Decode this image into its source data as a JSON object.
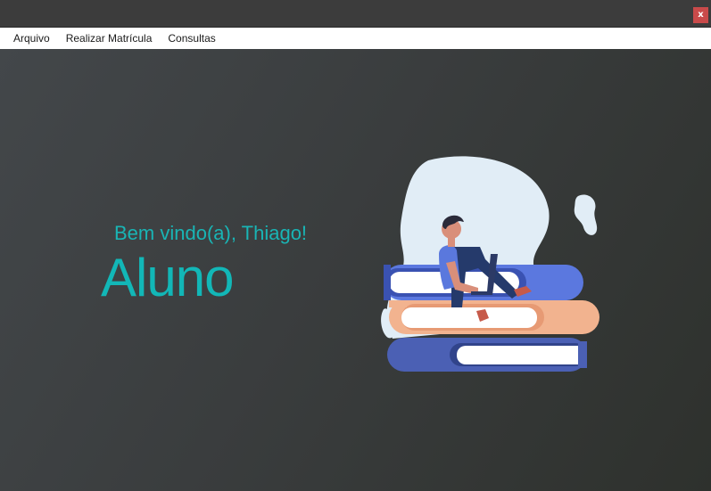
{
  "window": {
    "close_label": "x",
    "close_color": "#c94a4a"
  },
  "menu": {
    "items": [
      "Arquivo",
      "Realizar Matrícula",
      "Consultas"
    ]
  },
  "main": {
    "welcome": "Bem vindo(a), Thiago!",
    "role": "Aluno",
    "accent_color": "#12b7b7",
    "illustration_icon": "student-reading-on-books-illustration"
  }
}
